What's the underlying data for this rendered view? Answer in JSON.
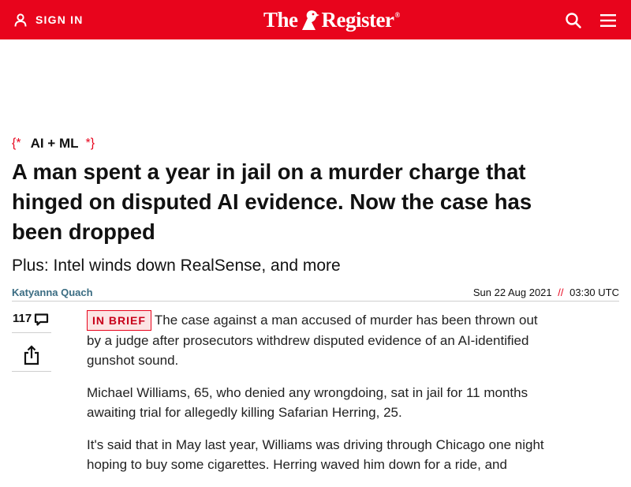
{
  "header": {
    "sign_in_label": "SIGN IN",
    "logo": {
      "part1": "The",
      "part2": "Register",
      "trademark": "®"
    },
    "accent_color": "#e8041c",
    "icons": {
      "account": "user-icon",
      "search": "search-icon",
      "menu": "hamburger-menu-icon",
      "logo": "vulture-logo-icon"
    }
  },
  "article": {
    "section": {
      "open_brace": "{*",
      "label": "AI + ML",
      "close_brace": "*}"
    },
    "headline": "A man spent a year in jail on a murder charge that hinged on disputed AI evidence. Now the case has been dropped",
    "standfirst": "Plus: Intel winds down RealSense, and more",
    "author": "Katyanna Quach",
    "date": "Sun 22 Aug 2021",
    "date_separator": "//",
    "time": "03:30 UTC",
    "comment_count": "117",
    "badge": "IN BRIEF",
    "paragraphs": [
      "The case against a man accused of murder has been thrown out by a judge after prosecutors withdrew disputed evidence of an AI-identified gunshot sound.",
      "Michael Williams, 65, who denied any wrongdoing, sat in jail for 11 months awaiting trial for allegedly killing Safarian Herring, 25.",
      "It's said that in May last year, Williams was driving through Chicago one night hoping to buy some cigarettes. Herring waved him down for a ride, and"
    ]
  }
}
